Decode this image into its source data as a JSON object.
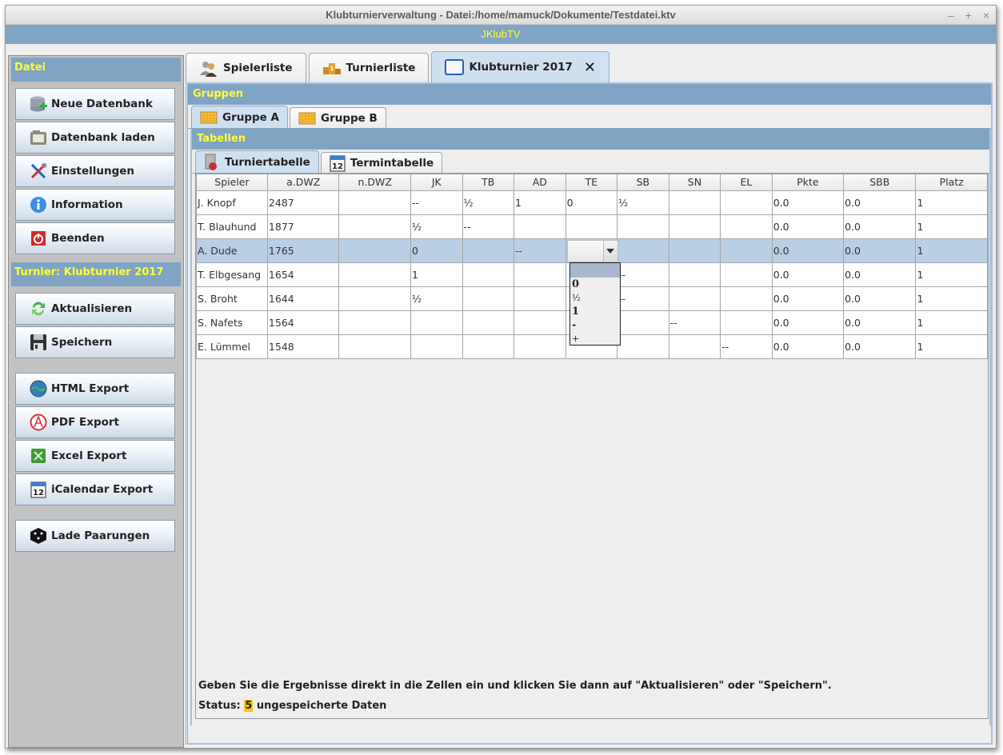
{
  "window": {
    "title": "Klubturnierverwaltung - Datei:/home/mamuck/Dokumente/Testdatei.ktv",
    "controls": {
      "minimize": "–",
      "maximize": "+",
      "close": "×"
    }
  },
  "app_bar": {
    "title": "JKlubTV"
  },
  "sidebar": {
    "file_header": "Datei",
    "file_buttons": [
      {
        "label": "Neue Datenbank",
        "icon": "database-add-icon"
      },
      {
        "label": "Datenbank laden",
        "icon": "folder-open-icon"
      },
      {
        "label": "Einstellungen",
        "icon": "tools-icon"
      },
      {
        "label": "Information",
        "icon": "info-icon"
      },
      {
        "label": "Beenden",
        "icon": "power-icon"
      }
    ],
    "tournament_header": "Turnier: Klubturnier 2017",
    "tournament_buttons": [
      {
        "label": "Aktualisieren",
        "icon": "refresh-icon"
      },
      {
        "label": "Speichern",
        "icon": "floppy-disk-icon"
      }
    ],
    "export_buttons": [
      {
        "label": "HTML Export",
        "icon": "globe-icon"
      },
      {
        "label": "PDF Export",
        "icon": "pdf-icon"
      },
      {
        "label": "Excel Export",
        "icon": "excel-icon"
      },
      {
        "label": "iCalendar Export",
        "icon": "calendar-icon"
      }
    ],
    "pairing_button": {
      "label": "Lade Paarungen",
      "icon": "dice-icon"
    }
  },
  "main_tabs": [
    {
      "label": "Spielerliste",
      "icon": "players-icon",
      "active": false
    },
    {
      "label": "Turnierliste",
      "icon": "podium-icon",
      "active": false
    },
    {
      "label": "Klubturnier 2017",
      "icon": "window-icon",
      "active": true,
      "closable": true
    }
  ],
  "groups": {
    "header": "Gruppen",
    "tabs": [
      {
        "label": "Gruppe A",
        "active": true
      },
      {
        "label": "Gruppe B",
        "active": false
      }
    ]
  },
  "tables": {
    "header": "Tabellen",
    "tabs": [
      {
        "label": "Turniertabelle",
        "icon": "table-icon",
        "active": true
      },
      {
        "label": "Termintabelle",
        "icon": "calendar-icon",
        "active": false
      }
    ]
  },
  "tournament_table": {
    "columns": [
      "Spieler",
      "a.DWZ",
      "n.DWZ",
      "JK",
      "TB",
      "AD",
      "TE",
      "SB",
      "SN",
      "EL",
      "Pkte",
      "SBB",
      "Platz"
    ],
    "rows": [
      [
        "J. Knopf",
        "2487",
        "",
        "--",
        "½",
        "1",
        "0",
        "½",
        "",
        "",
        "0.0",
        "0.0",
        "1"
      ],
      [
        "T. Blauhund",
        "1877",
        "",
        "½",
        "--",
        "",
        "",
        "",
        "",
        "",
        "0.0",
        "0.0",
        "1"
      ],
      [
        "A. Dude",
        "1765",
        "",
        "0",
        "",
        "--",
        "",
        "",
        "",
        "",
        "0.0",
        "0.0",
        "1"
      ],
      [
        "T. Elbgesang",
        "1654",
        "",
        "1",
        "",
        "",
        "",
        "--",
        "",
        "",
        "0.0",
        "0.0",
        "1"
      ],
      [
        "S. Broht",
        "1644",
        "",
        "½",
        "",
        "",
        "",
        "--",
        "",
        "",
        "0.0",
        "0.0",
        "1"
      ],
      [
        "S. Nafets",
        "1564",
        "",
        "",
        "",
        "",
        "",
        "",
        "--",
        "",
        "0.0",
        "0.0",
        "1"
      ],
      [
        "E. Lümmel",
        "1548",
        "",
        "",
        "",
        "",
        "",
        "",
        "",
        "--",
        "0.0",
        "0.0",
        "1"
      ]
    ],
    "selected_row": 2,
    "editing_cell": {
      "row": 2,
      "column": "TE",
      "value": ""
    },
    "dropdown_options": [
      "",
      "0",
      "½",
      "1",
      "-",
      "+"
    ]
  },
  "footer": {
    "hint": "Geben Sie die Ergebnisse direkt in die Zellen ein und klicken Sie dann auf \"Aktualisieren\" oder \"Speichern\".",
    "status_prefix": "Status:",
    "status_count": "5",
    "status_suffix": "ungespeicherte Daten"
  }
}
